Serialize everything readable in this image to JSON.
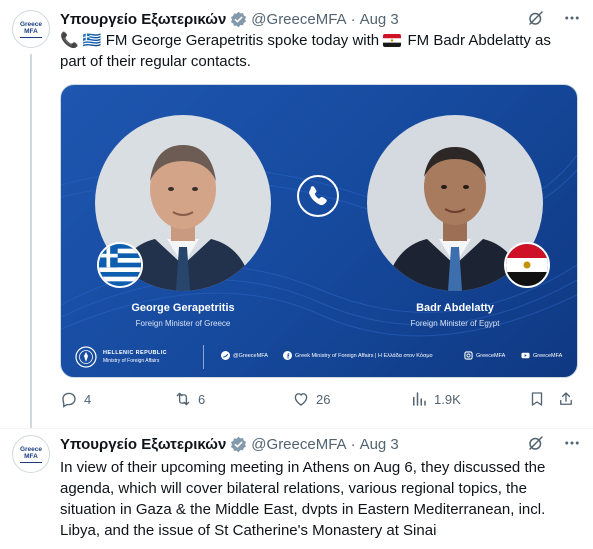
{
  "tweets": [
    {
      "author": {
        "name": "Υπουργείο Εξωτερικών",
        "handle": "@GreeceMFA",
        "avatar_line1": "Greece",
        "avatar_line2": "MFA"
      },
      "time": "Aug 3",
      "text_a": "🇬🇷 FM George Gerapetritis spoke today with",
      "text_b": "FM Badr Abdelatty as part of their regular contacts.",
      "card": {
        "left_name": "George Gerapetritis",
        "left_title": "Foreign Minister of Greece",
        "right_name": "Badr Abdelatty",
        "right_title": "Foreign Minister of Egypt",
        "republic": "HELLENIC REPUBLIC",
        "ministry": "Ministry of Foreign Affairs",
        "twitter": "@GreeceMFA",
        "facebook": "Greek Ministry of Foreign Affairs | Η Ελλάδα στον Κόσμο",
        "instagram": "GreeceMFA",
        "youtube": "GreeceMFA"
      },
      "stats": {
        "replies": "4",
        "reposts": "6",
        "likes": "26",
        "views": "1.9K"
      }
    },
    {
      "author": {
        "name": "Υπουργείο Εξωτερικών",
        "handle": "@GreeceMFA",
        "avatar_line1": "Greece",
        "avatar_line2": "MFA"
      },
      "time": "Aug 3",
      "text": "In view of their upcoming meeting in Athens on Aug 6, they discussed the agenda, which will cover bilateral relations, various regional topics, the situation in Gaza & the Middle East, dvpts in Eastern Mediterranean, incl. Libya, and the issue of St Catherine's Monastery at Sinai"
    }
  ],
  "dot": "·",
  "colors": {
    "card_blue": "#1a4fa5",
    "verified_gray": "#829aab",
    "muted": "#536471"
  },
  "icons": [
    "verified-icon",
    "grok-icon",
    "more-icon",
    "phone-icon",
    "reply-icon",
    "repost-icon",
    "like-icon",
    "views-icon",
    "bookmark-icon",
    "share-icon"
  ]
}
